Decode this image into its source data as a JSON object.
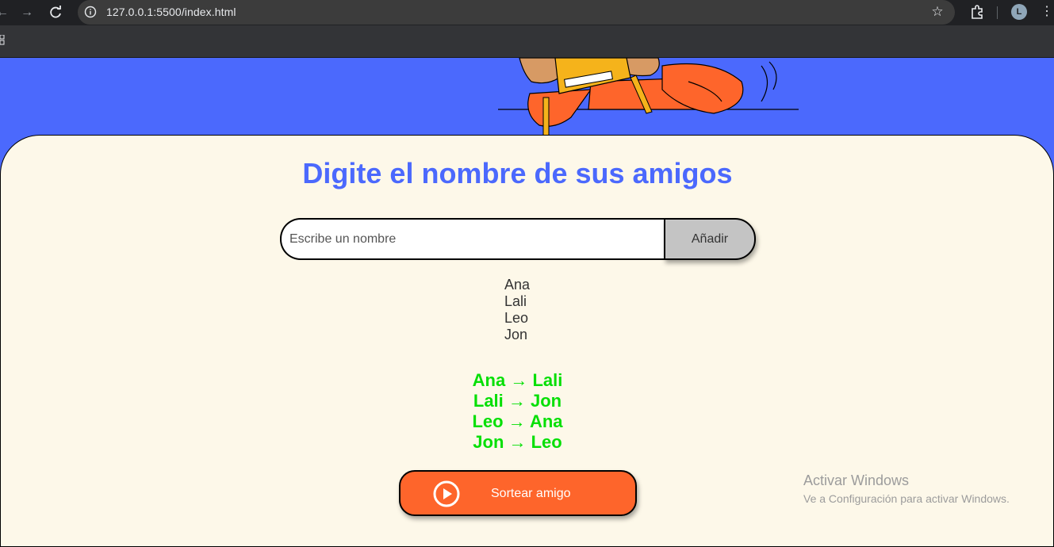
{
  "browser": {
    "url": "127.0.0.1:5500/index.html",
    "avatar_letter": "L",
    "icons": [
      "back-icon",
      "forward-icon",
      "reload-icon",
      "info-icon",
      "star-icon",
      "extensions-icon",
      "kebab-menu-icon"
    ]
  },
  "page": {
    "title": "Digite el nombre de sus amigos",
    "input_placeholder": "Escribe un nombre",
    "add_button_label": "Añadir",
    "friends": [
      "Ana",
      "Lali",
      "Leo",
      "Jon"
    ],
    "results": [
      "Ana → Lali",
      "Lali → Jon",
      "Leo → Ana",
      "Jon → Leo"
    ],
    "draw_button_label": "Sortear amigo"
  },
  "watermark": {
    "title": "Activar Windows",
    "subtitle": "Ve a Configuración para activar Windows."
  },
  "colors": {
    "hero_bg": "#4b69fd",
    "card_bg": "#fdf8e9",
    "title": "#4b69fd",
    "results": "#05df05",
    "draw_button": "#fe652b",
    "add_button": "#c4c4c4"
  }
}
